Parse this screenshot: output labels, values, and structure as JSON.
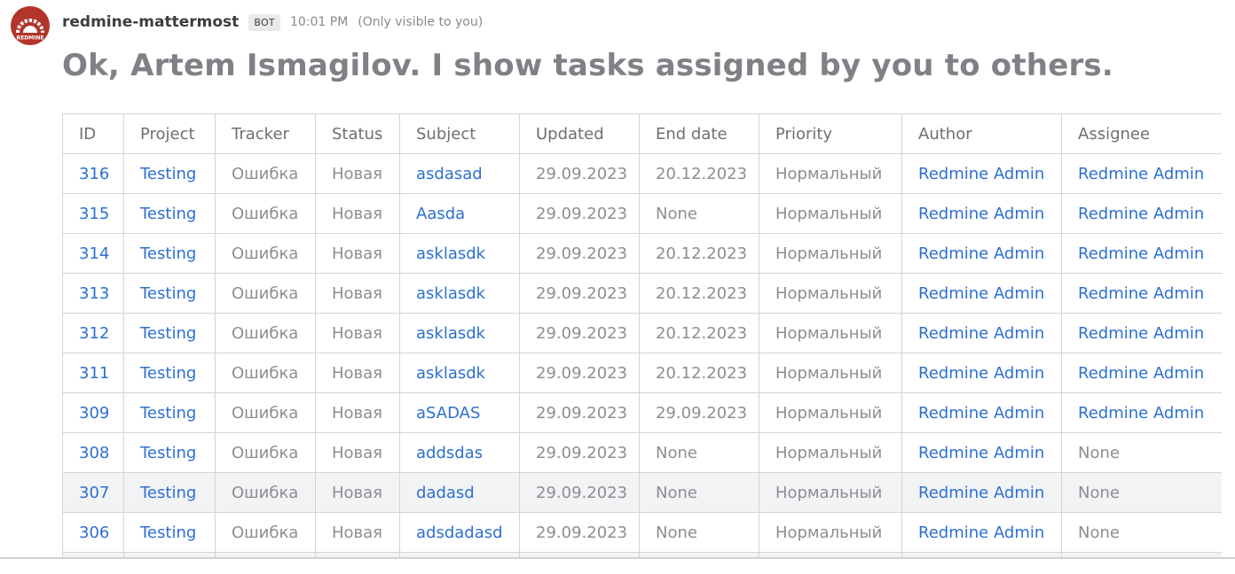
{
  "post": {
    "username": "redmine-mattermost",
    "badge": "BOT",
    "time": "10:01 PM",
    "visibility": "(Only visible to you)",
    "avatar_icon": "redmine-logo-icon",
    "avatar_text": "REDMINE",
    "message": "Ok, Artem Ismagilov. I show tasks assigned by you to others."
  },
  "colors": {
    "link": "#2d6fd2",
    "text_muted": "#8d8d93",
    "header_text": "#6f6f75",
    "avatar_bg": "#b3342b",
    "row_highlight": "#f2f3f5"
  },
  "table": {
    "headers": [
      "ID",
      "Project",
      "Tracker",
      "Status",
      "Subject",
      "Updated",
      "End date",
      "Priority",
      "Author",
      "Assignee"
    ],
    "rows": [
      [
        "316",
        "Testing",
        "Ошибка",
        "Новая",
        "asdasad",
        "29.09.2023",
        "20.12.2023",
        "Нормальный",
        "Redmine Admin",
        "Redmine Admin"
      ],
      [
        "315",
        "Testing",
        "Ошибка",
        "Новая",
        "Aasda",
        "29.09.2023",
        "None",
        "Нормальный",
        "Redmine Admin",
        "Redmine Admin"
      ],
      [
        "314",
        "Testing",
        "Ошибка",
        "Новая",
        "asklasdk",
        "29.09.2023",
        "20.12.2023",
        "Нормальный",
        "Redmine Admin",
        "Redmine Admin"
      ],
      [
        "313",
        "Testing",
        "Ошибка",
        "Новая",
        "asklasdk",
        "29.09.2023",
        "20.12.2023",
        "Нормальный",
        "Redmine Admin",
        "Redmine Admin"
      ],
      [
        "312",
        "Testing",
        "Ошибка",
        "Новая",
        "asklasdk",
        "29.09.2023",
        "20.12.2023",
        "Нормальный",
        "Redmine Admin",
        "Redmine Admin"
      ],
      [
        "311",
        "Testing",
        "Ошибка",
        "Новая",
        "asklasdk",
        "29.09.2023",
        "20.12.2023",
        "Нормальный",
        "Redmine Admin",
        "Redmine Admin"
      ],
      [
        "309",
        "Testing",
        "Ошибка",
        "Новая",
        "aSADAS",
        "29.09.2023",
        "29.09.2023",
        "Нормальный",
        "Redmine Admin",
        "Redmine Admin"
      ],
      [
        "308",
        "Testing",
        "Ошибка",
        "Новая",
        "addsdas",
        "29.09.2023",
        "None",
        "Нормальный",
        "Redmine Admin",
        "None"
      ],
      [
        "307",
        "Testing",
        "Ошибка",
        "Новая",
        "dadasd",
        "29.09.2023",
        "None",
        "Нормальный",
        "Redmine Admin",
        "None"
      ],
      [
        "306",
        "Testing",
        "Ошибка",
        "Новая",
        "adsdadasd",
        "29.09.2023",
        "None",
        "Нормальный",
        "Redmine Admin",
        "None"
      ],
      [
        "",
        "",
        "",
        "",
        "",
        "",
        "",
        "",
        "",
        ""
      ]
    ]
  }
}
